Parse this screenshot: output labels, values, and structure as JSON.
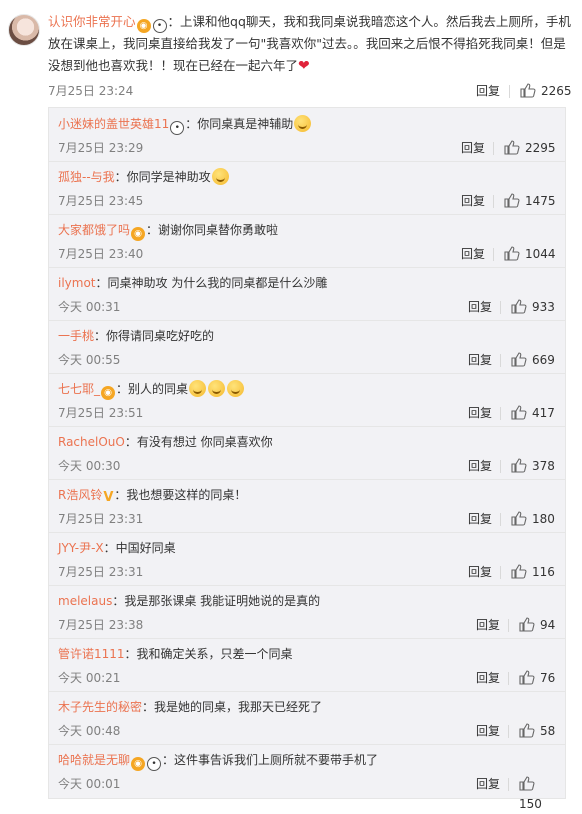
{
  "main_comment": {
    "username": "认识你非常开心",
    "text": "：上课和他qq聊天，我和我同桌说我暗恋这个人。然后我去上厕所，手机放在课桌上，我同桌直接给我发了一句\"我喜欢你\"过去。。我回来之后恨不得掐死我同桌！但是没想到他也喜欢我！！现在已经在一起六年了",
    "time": "7月25日 23:24",
    "reply_label": "回复",
    "likes": "2265"
  },
  "replies": [
    {
      "username": "小迷妹的盖世英雄11",
      "text": "：你同桌真是神辅助",
      "time": "7月25日 23:29",
      "reply_label": "回复",
      "likes": "2295"
    },
    {
      "username": "孤独--与我",
      "text": "：你同学是神助攻",
      "time": "7月25日 23:45",
      "reply_label": "回复",
      "likes": "1475"
    },
    {
      "username": "大家都饿了吗",
      "text": "：谢谢你同桌替你勇敢啦",
      "time": "7月25日 23:40",
      "reply_label": "回复",
      "likes": "1044"
    },
    {
      "username": "ilymot",
      "text": "：同桌神助攻 为什么我的同桌都是什么沙雕",
      "time": "今天 00:31",
      "reply_label": "回复",
      "likes": "933"
    },
    {
      "username": "一手桃",
      "text": "：你得请同桌吃好吃的",
      "time": "今天 00:55",
      "reply_label": "回复",
      "likes": "669"
    },
    {
      "username": "七七耶_",
      "text": "：别人的同桌",
      "time": "7月25日 23:51",
      "reply_label": "回复",
      "likes": "417"
    },
    {
      "username": "RachelOuO",
      "text": "：有没有想过 你同桌喜欢你",
      "time": "今天 00:30",
      "reply_label": "回复",
      "likes": "378"
    },
    {
      "username": "R浩风铃",
      "text": "：我也想要这样的同桌！",
      "time": "7月25日 23:31",
      "reply_label": "回复",
      "likes": "180"
    },
    {
      "username": "JYY-尹-X",
      "text": "：中国好同桌",
      "time": "7月25日 23:31",
      "reply_label": "回复",
      "likes": "116"
    },
    {
      "username": "melelaus",
      "text": "：我是那张课桌 我能证明她说的是真的",
      "time": "7月25日 23:38",
      "reply_label": "回复",
      "likes": "94"
    },
    {
      "username": "管许诺1111",
      "text": "：我和确定关系，只差一个同桌",
      "time": "今天 00:21",
      "reply_label": "回复",
      "likes": "76"
    },
    {
      "username": "木子先生的秘密",
      "text": "：我是她的同桌，我那天已经死了",
      "time": "今天 00:48",
      "reply_label": "回复",
      "likes": "58"
    },
    {
      "username": "哈哈就是无聊",
      "text": "：这件事告诉我们上厕所就不要带手机了",
      "time": "今天 00:01",
      "reply_label": "回复",
      "likes": "150"
    }
  ],
  "colors": {
    "username": "#eb7350",
    "meta": "#808080",
    "panel_bg": "#f2f2f5",
    "heart": "#e0233a"
  }
}
